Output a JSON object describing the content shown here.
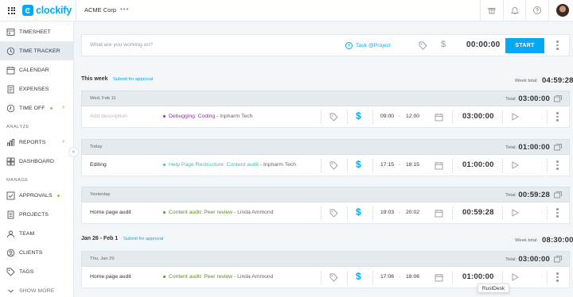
{
  "header": {
    "app_name": "clockify",
    "workspace": "ACME Corp",
    "more": "•••",
    "icons": [
      "gift-icon",
      "bell-icon",
      "help-icon"
    ]
  },
  "sidebar": {
    "items": [
      {
        "label": "TIMESHEET",
        "icon": "timesheet-icon"
      },
      {
        "label": "TIME TRACKER",
        "icon": "clock-icon",
        "active": true
      },
      {
        "label": "CALENDAR",
        "icon": "calendar-icon"
      },
      {
        "label": "EXPENSES",
        "icon": "expenses-icon"
      },
      {
        "label": "TIME OFF",
        "icon": "time-off-icon",
        "dot": true,
        "chevron": true
      }
    ],
    "analyze_label": "ANALYZE",
    "analyze_items": [
      {
        "label": "REPORTS",
        "icon": "reports-icon",
        "chevron": true
      },
      {
        "label": "DASHBOARD",
        "icon": "dashboard-icon"
      }
    ],
    "manage_label": "MANAGE",
    "manage_items": [
      {
        "label": "APPROVALS",
        "icon": "approvals-icon",
        "dot": true
      },
      {
        "label": "PROJECTS",
        "icon": "projects-icon"
      },
      {
        "label": "TEAM",
        "icon": "team-icon"
      },
      {
        "label": "CLIENTS",
        "icon": "clients-icon"
      },
      {
        "label": "TAGS",
        "icon": "tags-icon"
      }
    ],
    "show_more": "SHOW MORE"
  },
  "tracker": {
    "placeholder": "What are you working on?",
    "task_label": "Task @Project",
    "timer": "00:00:00",
    "start_label": "START"
  },
  "weeks": [
    {
      "title": "This week",
      "submit": "Submit for approval",
      "total_label": "Week total:",
      "total": "04:59:28",
      "days": [
        {
          "label": "Wed, Feb 11",
          "total_label": "Total:",
          "total": "03:00:00",
          "entries": [
            {
              "description": "",
              "placeholder": "Add description",
              "project": "Debugging: Coding",
              "client": "Inpharm Tech",
              "color": "#9c27b0",
              "start": "09:00",
              "end": "12:00",
              "duration": "03:00:00"
            }
          ]
        },
        {
          "label": "Today",
          "total_label": "Total:",
          "total": "01:00:00",
          "entries": [
            {
              "description": "Editing",
              "project": "Help Page Restructure: Content audit",
              "client": "Inpharm Tech",
              "color": "#4cb5a9",
              "start": "17:15",
              "end": "18:15",
              "duration": "01:00:00"
            }
          ]
        },
        {
          "label": "Yesterday",
          "total_label": "Total:",
          "total": "00:59:28",
          "entries": [
            {
              "description": "Home page audit",
              "project": "Content audit: Peer review",
              "client": "Linda Ammond",
              "color": "#5a8f1f",
              "start": "19:03",
              "end": "20:02",
              "duration": "00:59:28"
            }
          ]
        }
      ]
    },
    {
      "title": "Jan 26 - Feb 1",
      "submit": "Submit for approval",
      "total_label": "Week total:",
      "total": "08:30:00",
      "days": [
        {
          "label": "Thu, Jan 29",
          "total_label": "Total:",
          "total": "03:00:00",
          "entries": [
            {
              "description": "Home page audit",
              "project": "Content audit: Peer review",
              "client": "Linda Ammond",
              "color": "#5a8f1f",
              "start": "17:06",
              "end": "18:06",
              "duration": "01:00:00"
            }
          ]
        }
      ]
    }
  ],
  "tooltip": "RustDesk",
  "colors": {
    "accent": "#03a9f4",
    "orange_dot": "#f09c28"
  }
}
